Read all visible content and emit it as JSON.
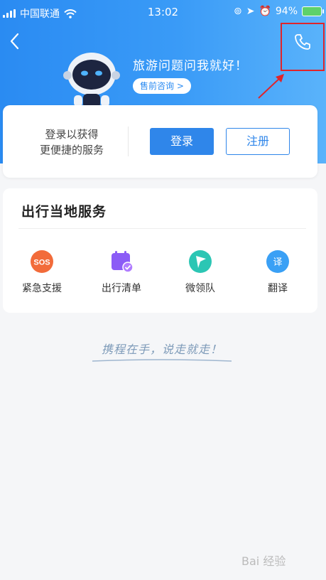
{
  "status_bar": {
    "carrier": "中国联通",
    "time": "13:02",
    "battery": "94%"
  },
  "hero": {
    "title": "旅游问题问我就好！",
    "consult_label": "售前咨询 >"
  },
  "login_card": {
    "line1": "登录以获得",
    "line2": "更便捷的服务",
    "login_label": "登录",
    "register_label": "注册"
  },
  "services": {
    "title": "出行当地服务",
    "items": [
      {
        "label": "紧急支援",
        "icon": "sos-icon",
        "color": "#f26b3a"
      },
      {
        "label": "出行清单",
        "icon": "checklist-icon",
        "color": "#8b5cf6"
      },
      {
        "label": "微领队",
        "icon": "flag-icon",
        "color": "#2cc6b4"
      },
      {
        "label": "翻译",
        "icon": "translate-icon",
        "color": "#3aa0f5"
      }
    ]
  },
  "slogan": "携程在手，说走就走！",
  "watermark": "Bai 经验",
  "colors": {
    "accent": "#2f86ea",
    "highlight": "#e0242a"
  }
}
